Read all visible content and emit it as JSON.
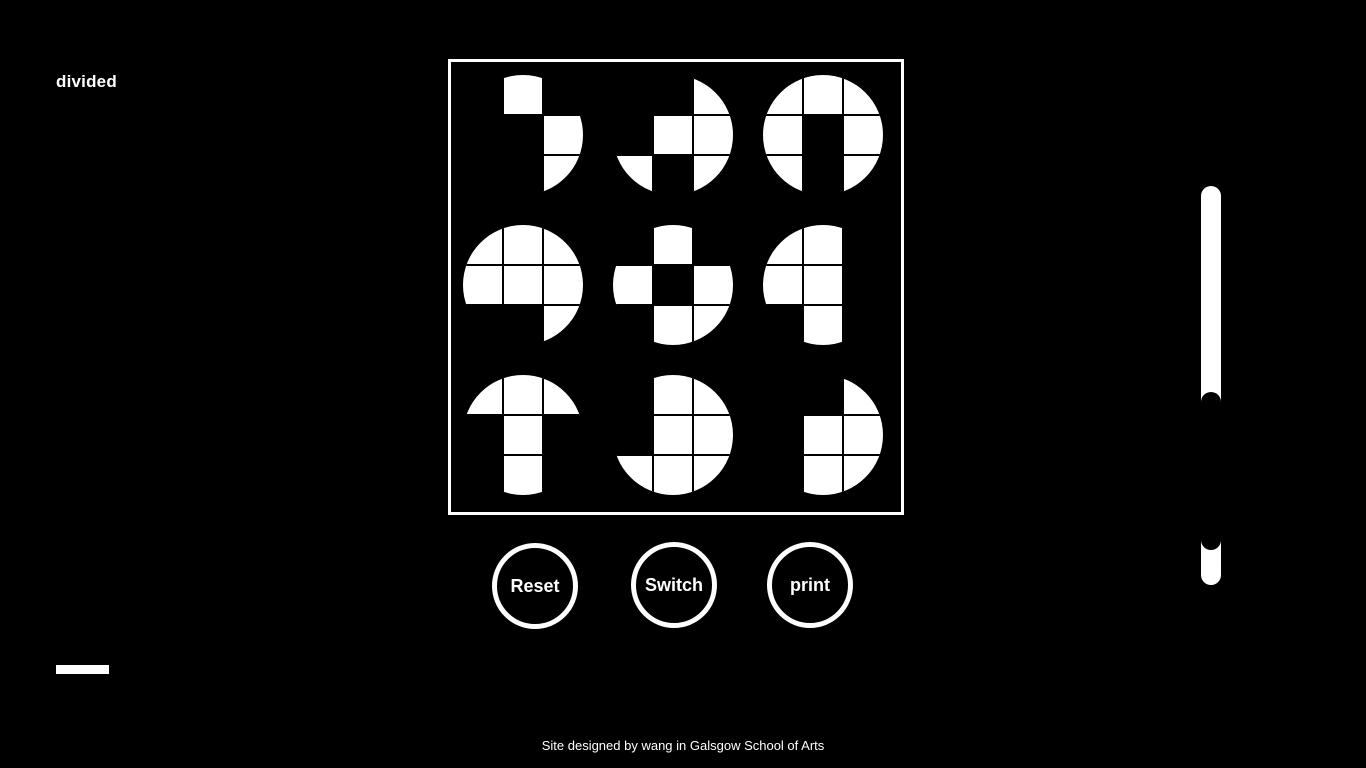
{
  "header": {
    "brand": "divided"
  },
  "board": {
    "note": "3x3 grid of circular glyphs, each split into a 3x3 tile grid; 1 = white tile visible, 0 = black",
    "glyphs": [
      [
        [
          0,
          1,
          0
        ],
        [
          0,
          0,
          1
        ],
        [
          0,
          0,
          1
        ]
      ],
      [
        [
          0,
          0,
          1
        ],
        [
          0,
          1,
          1
        ],
        [
          1,
          0,
          1
        ]
      ],
      [
        [
          1,
          1,
          1
        ],
        [
          1,
          0,
          1
        ],
        [
          1,
          0,
          1
        ]
      ],
      [
        [
          1,
          1,
          1
        ],
        [
          1,
          1,
          1
        ],
        [
          0,
          0,
          1
        ]
      ],
      [
        [
          0,
          1,
          0
        ],
        [
          1,
          0,
          1
        ],
        [
          0,
          1,
          1
        ]
      ],
      [
        [
          1,
          1,
          0
        ],
        [
          1,
          1,
          0
        ],
        [
          0,
          1,
          0
        ]
      ],
      [
        [
          1,
          1,
          1
        ],
        [
          0,
          1,
          0
        ],
        [
          0,
          1,
          0
        ]
      ],
      [
        [
          0,
          1,
          1
        ],
        [
          0,
          1,
          1
        ],
        [
          1,
          1,
          1
        ]
      ],
      [
        [
          0,
          0,
          1
        ],
        [
          0,
          1,
          1
        ],
        [
          0,
          1,
          1
        ]
      ]
    ]
  },
  "controls": {
    "reset_label": "Reset",
    "switch_label": "Switch",
    "print_label": "print"
  },
  "footer": {
    "credit": "Site designed by wang in Galsgow School of Arts"
  },
  "colors": {
    "background": "#000000",
    "foreground": "#ffffff"
  }
}
